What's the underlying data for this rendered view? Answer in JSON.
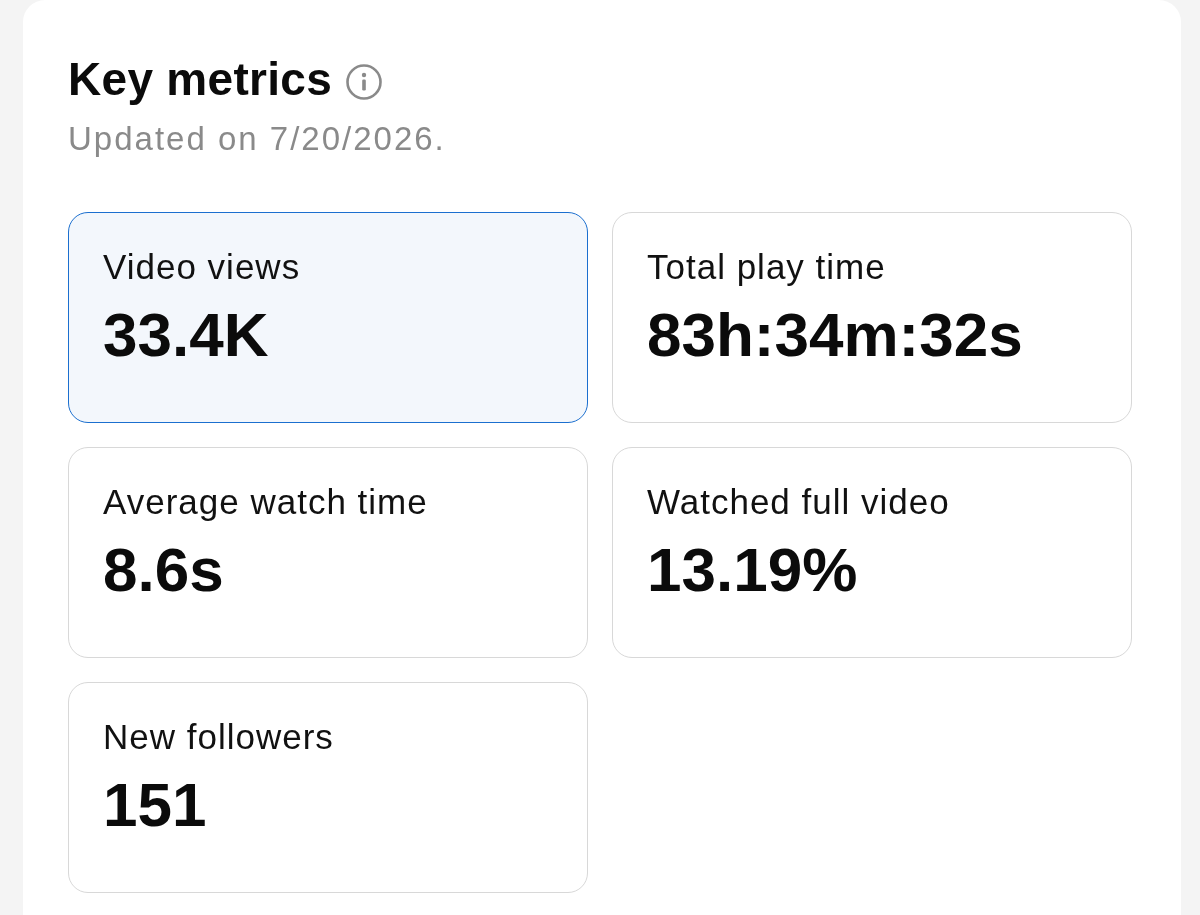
{
  "header": {
    "title": "Key metrics",
    "subtitle": "Updated on 7/20/2026."
  },
  "metrics": [
    {
      "label": "Video views",
      "value": "33.4K",
      "selected": true
    },
    {
      "label": "Total play time",
      "value": "83h:34m:32s",
      "selected": false
    },
    {
      "label": "Average watch time",
      "value": "8.6s",
      "selected": false
    },
    {
      "label": "Watched full video",
      "value": "13.19%",
      "selected": false
    },
    {
      "label": "New followers",
      "value": "151",
      "selected": false
    }
  ]
}
